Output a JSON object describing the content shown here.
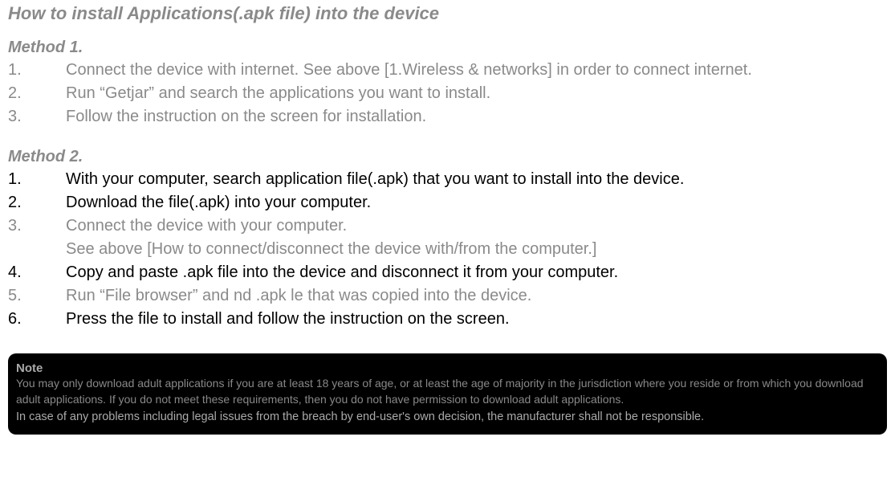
{
  "title": "How to install Applications(.apk file) into the device",
  "method1": {
    "heading": "Method 1.",
    "items": [
      {
        "num": "1.",
        "text": "Connect the device with internet. See above [1.Wireless & networks] in order to connect internet."
      },
      {
        "num": "2.",
        "text": "Run “Getjar” and search the applications you want to install."
      },
      {
        "num": "3.",
        "text": "Follow the instruction on the screen for installation."
      }
    ]
  },
  "method2": {
    "heading": "Method 2.",
    "items": [
      {
        "num": "1.",
        "text": "With your computer, search application file(.apk) that you want to install into the device.",
        "style": "black"
      },
      {
        "num": "2.",
        "text": "Download the file(.apk) into your computer.",
        "style": "black"
      },
      {
        "num": "3.",
        "text": "Connect the device with your computer.",
        "style": "gray",
        "sub": "See above [How to connect/disconnect the device with/from the computer.]"
      },
      {
        "num": "4.",
        "text": "Copy and paste .apk file into the device and disconnect it from your computer.",
        "style": "black"
      },
      {
        "num": "5.",
        "text": "Run “File browser” and  nd .apk  le that was copied into the device.",
        "style": "gray"
      },
      {
        "num": "6.",
        "text": "Press the file to install and follow the instruction on the screen.",
        "style": "black"
      }
    ]
  },
  "note": {
    "title": "Note",
    "body1": "You may only download adult applications if you are at least 18 years of age, or at least the age of majority in the jurisdiction where you reside or from which you download adult applications. If you do not meet these requirements, then you do not have permission to download adult applications.",
    "body2": "In case of any problems including legal issues from the breach by end-user's own decision, the manufacturer shall not be responsible."
  }
}
